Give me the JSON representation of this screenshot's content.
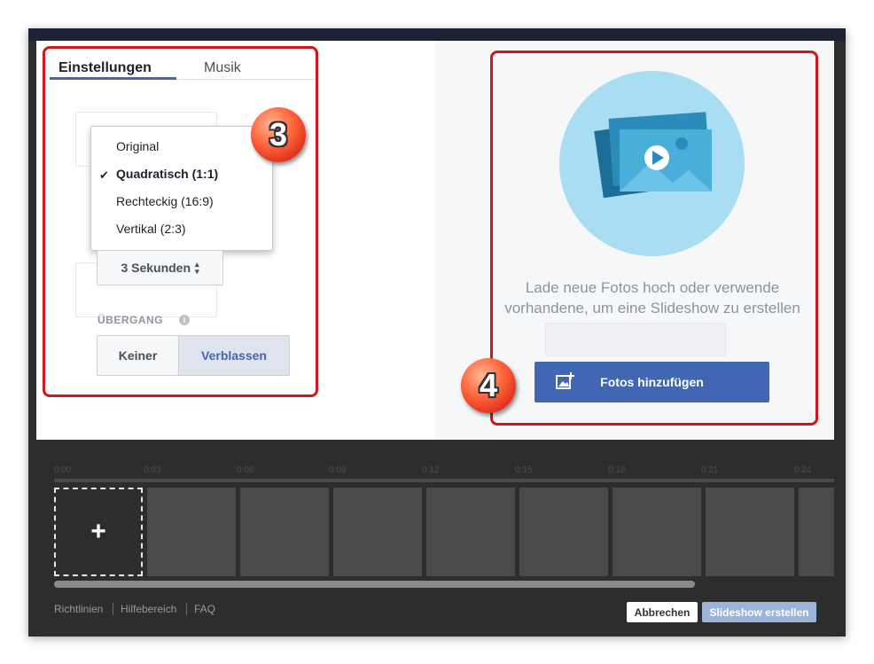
{
  "tabs": {
    "settings": "Einstellungen",
    "music": "Musik"
  },
  "dropdown": {
    "options": [
      "Original",
      "Quadratisch (1:1)",
      "Rechteckig (16:9)",
      "Vertikal (2:3)"
    ],
    "selected": "Quadratisch (1:1)"
  },
  "duration_select": {
    "value": "3 Sekunden"
  },
  "transition": {
    "label": "ÜBERGANG",
    "options": [
      "Keiner",
      "Verblassen"
    ],
    "selected": "Verblassen"
  },
  "upload": {
    "message": "Lade neue Fotos hoch oder verwende vorhandene, um eine Slideshow zu erstellen",
    "button_label": "Fotos hinzufügen"
  },
  "badges": [
    "3",
    "4"
  ],
  "timeline": {
    "ticks": [
      "0:00",
      "0:03",
      "0:06",
      "0:09",
      "0:12",
      "0:15",
      "0:18",
      "0:21",
      "0:24"
    ],
    "add_label": "+"
  },
  "footer": {
    "links": [
      "Richtlinien",
      "Hilfebereich",
      "FAQ"
    ],
    "cancel_label": "Abbrechen",
    "create_label": "Slideshow erstellen"
  },
  "colors": {
    "accent": "#4267b2",
    "highlight": "#d0161c",
    "badge": "#ff6a3d",
    "timeline_bg": "#2d2d2d"
  },
  "icons": [
    "photo-add-icon",
    "checkmark-icon",
    "info-icon",
    "plus-icon",
    "sort-arrows-icon",
    "slideshow-illustration"
  ]
}
